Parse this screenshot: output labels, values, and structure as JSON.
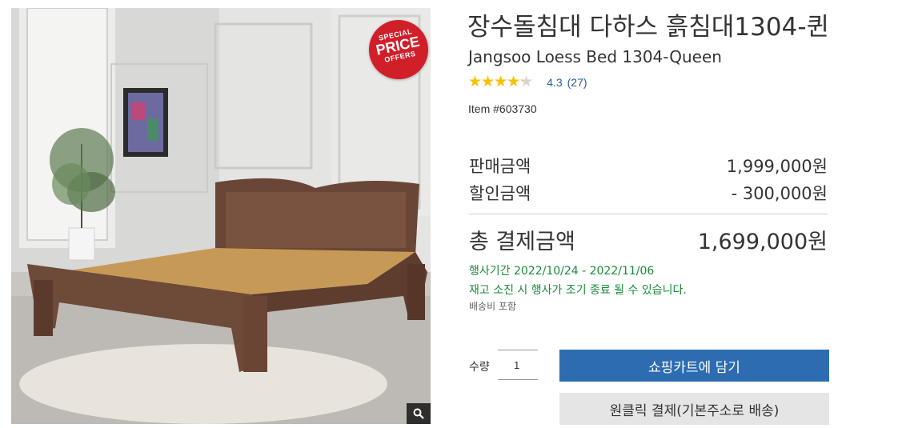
{
  "product": {
    "title_ko": "장수돌침대 다하스 흙침대1304-퀸",
    "title_en": "Jangsoo Loess Bed 1304-Queen",
    "rating_fraction": 0.86,
    "rating_value": "4.3",
    "rating_count": "(27)",
    "item_number": "Item #603730",
    "stars_glyphs": "★★★★★"
  },
  "badge": {
    "line1": "SPECIAL",
    "line2": "PRICE",
    "line3": "OFFERS",
    "color": "#d11f2a"
  },
  "pricing": {
    "sale_label": "판매금액",
    "sale_value": "1,999,000원",
    "discount_label": "할인금액",
    "discount_value": "- 300,000원",
    "total_label": "총 결제금액",
    "total_value": "1,699,000원"
  },
  "promo": {
    "period": "행사기간 2022/10/24 - 2022/11/06",
    "notice": "재고 소진 시 행사가 조기 종료 될 수 있습니다.",
    "color": "#1a8a3a"
  },
  "shipping_note": "배송비 포함",
  "purchase": {
    "qty_label": "수량",
    "qty_value": "1",
    "add_to_cart": "쇼핑카트에 담기",
    "one_click": "원클릭 결제(기본주소로 배송)",
    "accent": "#2d6cb0"
  },
  "icons": {
    "zoom": "magnifier-icon",
    "star": "star-icon"
  }
}
